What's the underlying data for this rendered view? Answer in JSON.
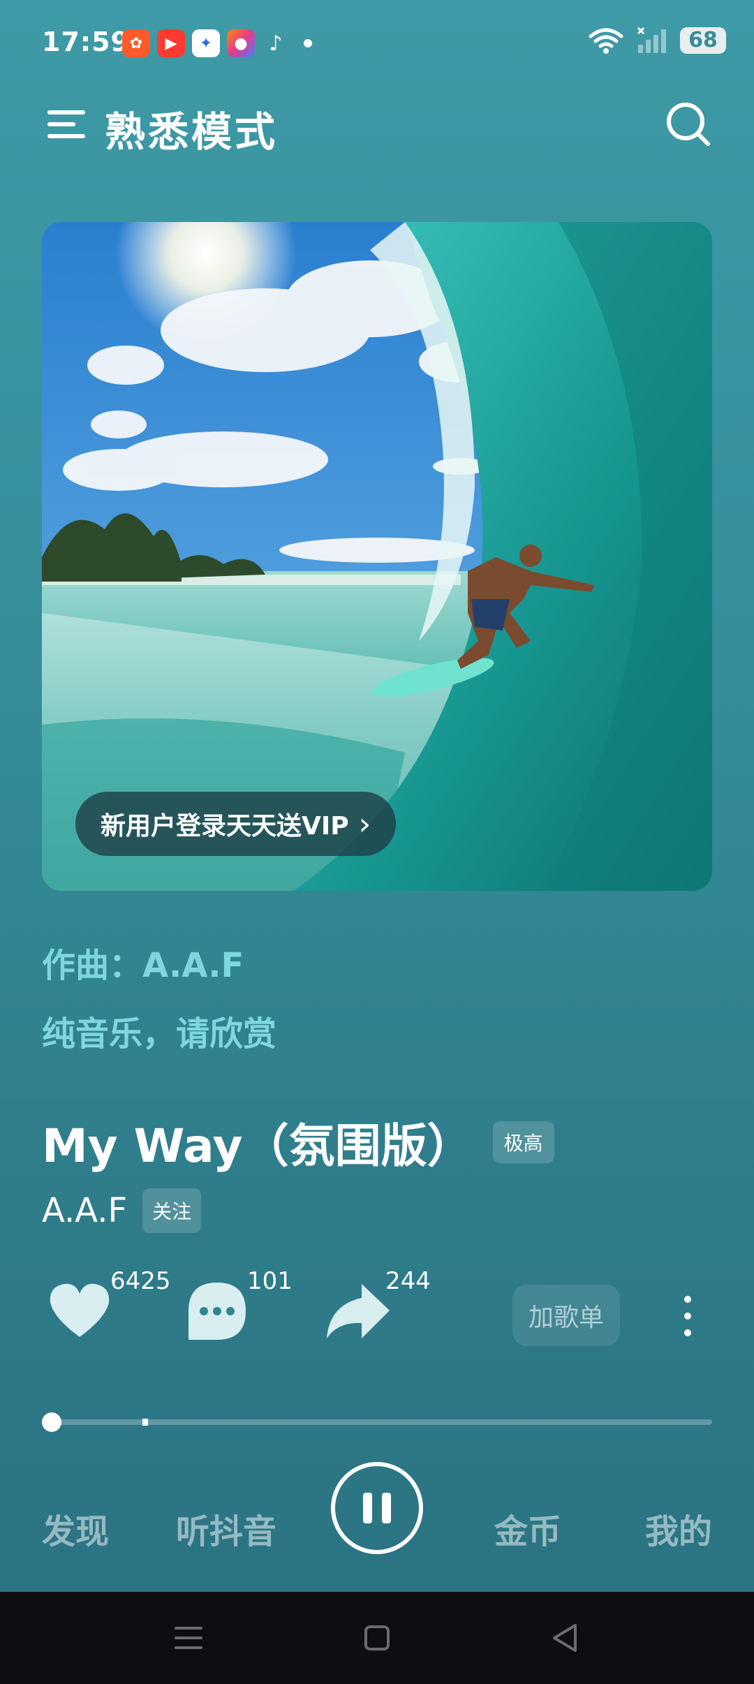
{
  "status_bar": {
    "time": "17:59",
    "battery": "68",
    "icons": [
      "wifi-icon",
      "signal-icon",
      "battery-icon"
    ]
  },
  "header": {
    "title": "熟悉模式",
    "menu_icon": "menu-icon",
    "search_icon": "search-icon"
  },
  "cover": {
    "promo_label": "新用户登录天天送VIP",
    "promo_arrow": "›"
  },
  "credits": {
    "composer": "作曲：A.A.F",
    "note": "纯音乐，请欣赏"
  },
  "song": {
    "title": "My Way（氛围版）",
    "quality": "极高",
    "artist": "A.A.F",
    "follow_label": "关注"
  },
  "actions": {
    "like_count": "6425",
    "comment_count": "101",
    "share_count": "244",
    "add_playlist_label": "加歌单"
  },
  "playback": {
    "progress_fraction": 0.014,
    "buffered_fraction": 0.15,
    "state": "playing"
  },
  "bottom_nav": {
    "discover": "发现",
    "douyin": "听抖音",
    "coins": "金币",
    "mine": "我的"
  },
  "colors": {
    "accent_text": "#7fd6e0",
    "background_top": "#3e9aa6",
    "background_bottom": "#2a7180"
  }
}
